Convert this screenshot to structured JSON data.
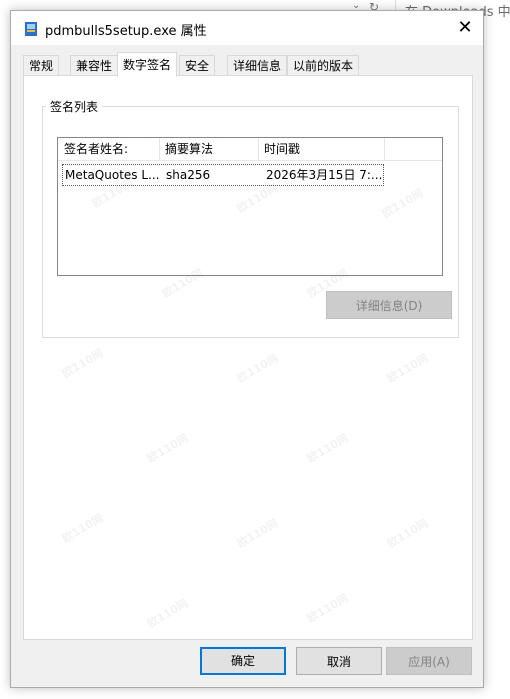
{
  "background": {
    "search_text": "在 Downloads 中搜"
  },
  "window": {
    "title": "pdmbulls5setup.exe 属性",
    "close_glyph": "✕"
  },
  "tabs": [
    {
      "label": "常规",
      "active": false
    },
    {
      "label": "兼容性",
      "active": false
    },
    {
      "label": "数字签名",
      "active": true
    },
    {
      "label": "安全",
      "active": false
    },
    {
      "label": "详细信息",
      "active": false
    },
    {
      "label": "以前的版本",
      "active": false
    }
  ],
  "signature_list": {
    "legend": "签名列表",
    "columns": [
      "签名者姓名:",
      "摘要算法",
      "时间戳"
    ],
    "rows": [
      {
        "signer": "MetaQuotes L...",
        "algorithm": "sha256",
        "timestamp": "2026年3月15日 7:..."
      }
    ]
  },
  "details_button": "详细信息(D)",
  "footer": {
    "ok_label": "确定",
    "cancel_label": "取消",
    "apply_label": "应用(A)"
  },
  "watermark_text": "欧110网",
  "colors": {
    "dialog_bg": "#f0f0f0",
    "page_bg": "#ffffff",
    "focus_border": "#0078d7",
    "disabled_text": "#838383"
  }
}
